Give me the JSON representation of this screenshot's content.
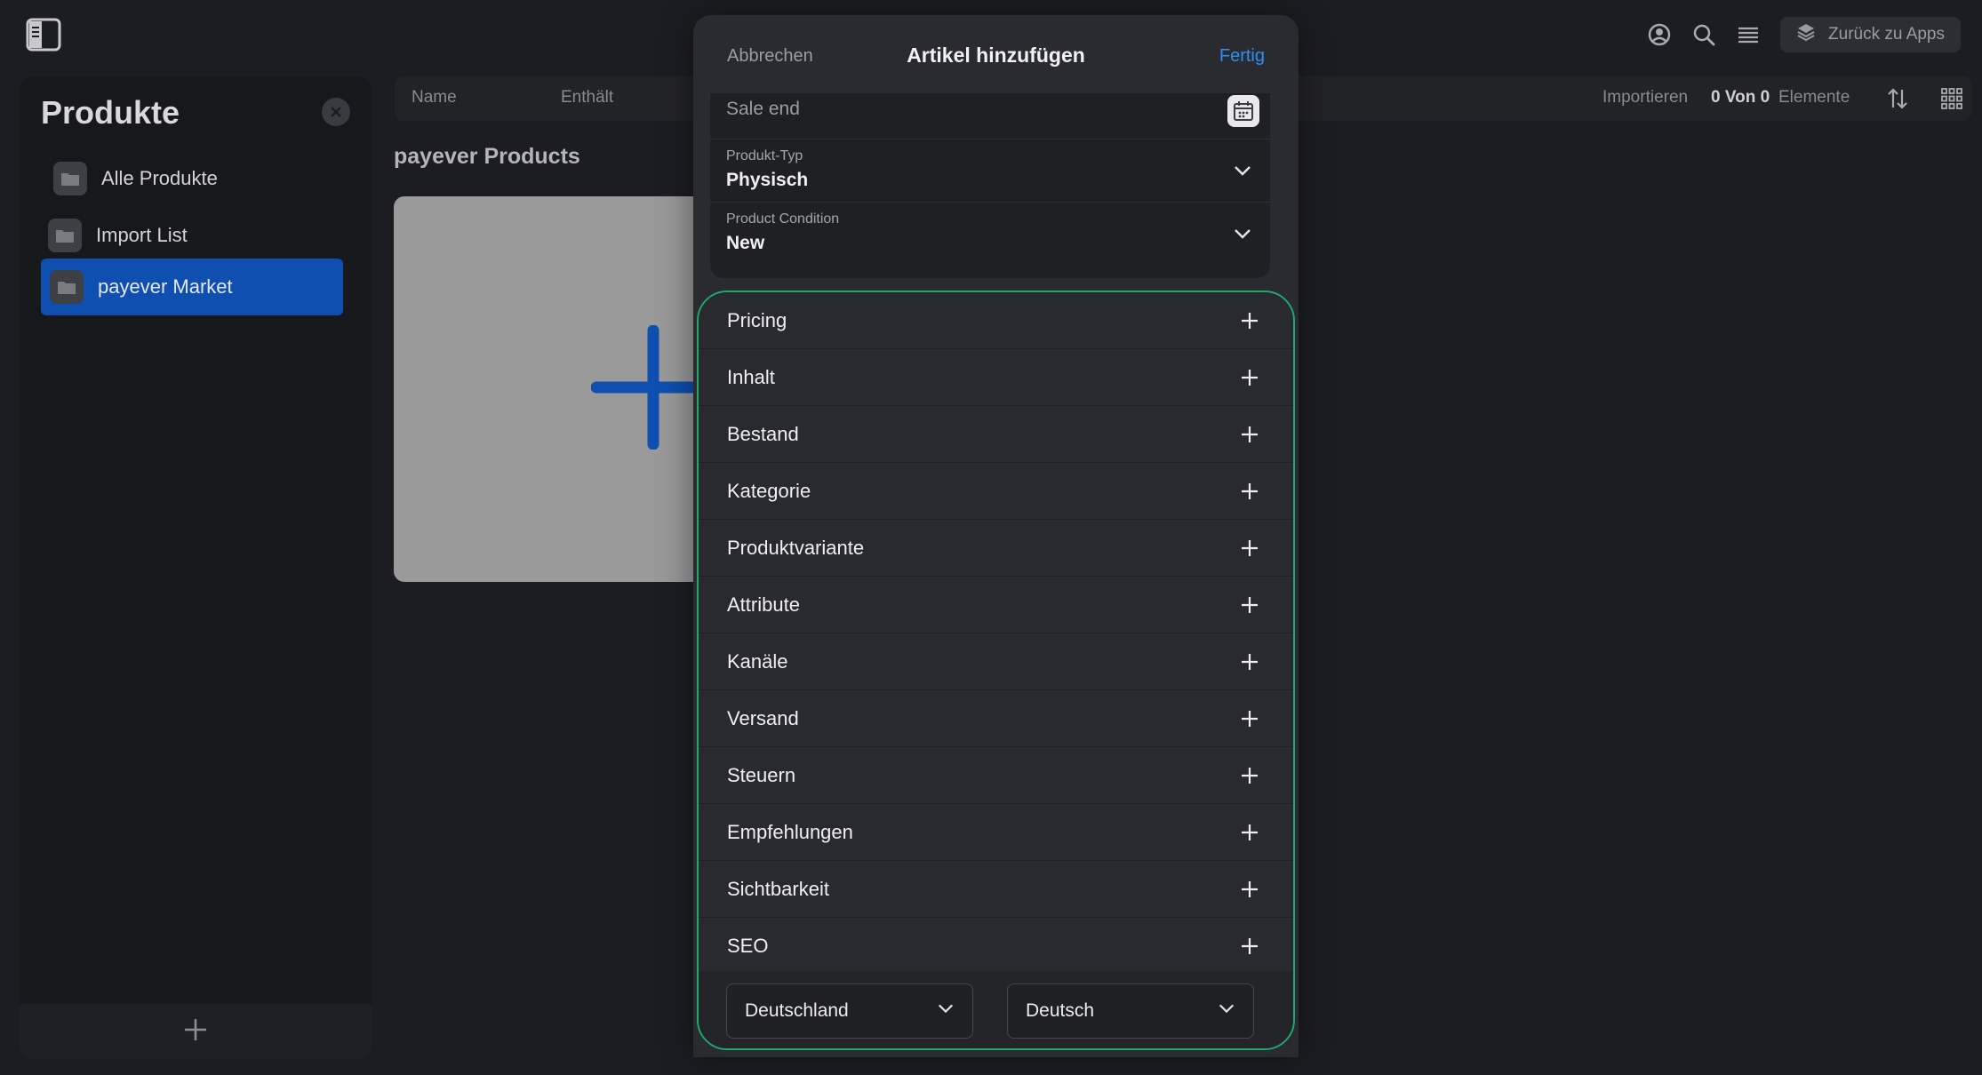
{
  "topbar": {
    "back_to_apps": "Zurück zu Apps",
    "icons": [
      "sidebar-toggle-icon",
      "user-circle-icon",
      "search-icon",
      "menu-lines-icon",
      "apps-layers-icon"
    ]
  },
  "sidebar": {
    "title": "Produkte",
    "folders": [
      {
        "label": "Alle Produkte",
        "active": false
      },
      {
        "label": "Import List",
        "active": false
      },
      {
        "label": "payever Market",
        "active": true
      }
    ]
  },
  "toolbar": {
    "columns": [
      "Name",
      "Enthält"
    ],
    "import_label": "Importieren",
    "count": "0 Von 0",
    "items_label": "Elemente"
  },
  "main": {
    "section_title": "payever Products"
  },
  "modal": {
    "cancel": "Abbrechen",
    "title": "Artikel hinzufügen",
    "done": "Fertig",
    "sale_end_label": "Sale end",
    "product_type": {
      "label": "Produkt-Typ",
      "value": "Physisch"
    },
    "product_condition": {
      "label": "Product Condition",
      "value": "New"
    },
    "sections": [
      "Pricing",
      "Inhalt",
      "Bestand",
      "Kategorie",
      "Produktvariante",
      "Attribute",
      "Kanäle",
      "Versand",
      "Steuern",
      "Empfehlungen",
      "Sichtbarkeit",
      "SEO"
    ],
    "country": "Deutschland",
    "language": "Deutsch"
  },
  "colors": {
    "accent_blue": "#2e8ff0",
    "active_folder": "#0f4fb0",
    "highlight_green": "#1fa86c"
  }
}
